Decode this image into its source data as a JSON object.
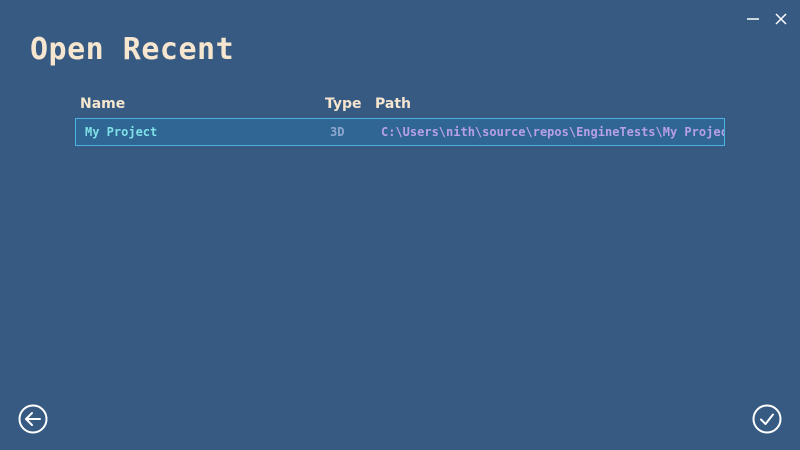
{
  "window": {
    "controls": [
      {
        "name": "minimize",
        "icon": "minimize-icon"
      },
      {
        "name": "close",
        "icon": "close-icon"
      }
    ]
  },
  "title": "Open Recent",
  "table": {
    "headers": {
      "name": "Name",
      "type": "Type",
      "path": "Path"
    },
    "rows": [
      {
        "name": "My Project",
        "type": "3D",
        "path": "C:\\Users\\nith\\source\\repos\\EngineTests\\My Project",
        "selected": true
      }
    ]
  },
  "footer": {
    "back_icon": "arrow-left-circle-icon",
    "confirm_icon": "check-circle-icon"
  },
  "colors": {
    "background": "#375a82",
    "title": "#f6e6d0",
    "selected_row": "#2f6694",
    "selected_border": "#4db1df",
    "name_text": "#7fe0e6",
    "path_text": "#b8a0e6"
  }
}
